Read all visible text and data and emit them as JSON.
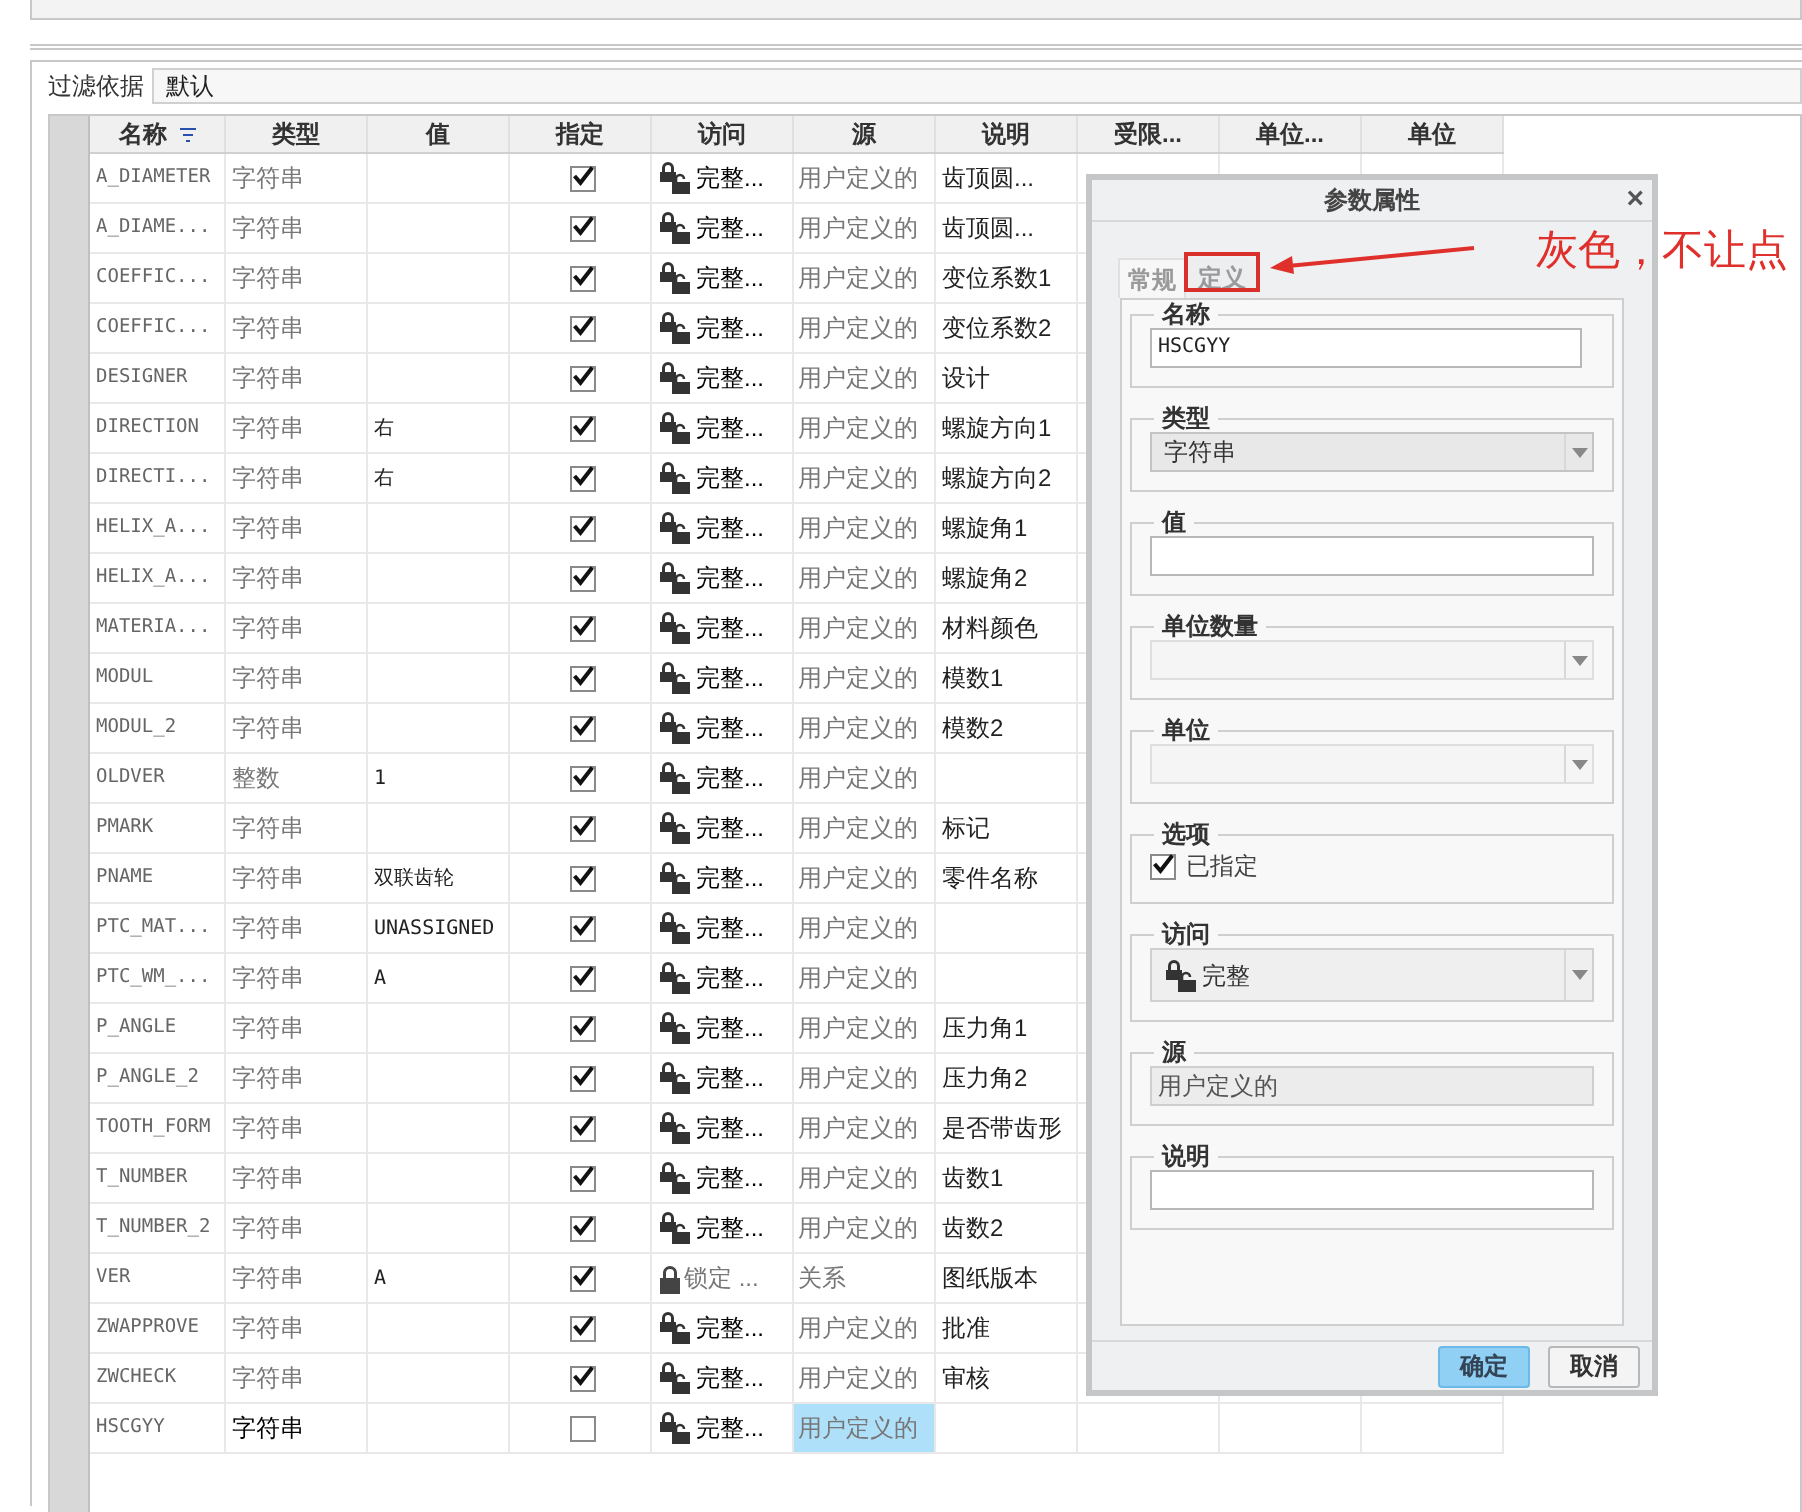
{
  "filter": {
    "label": "过滤依据",
    "value": "默认"
  },
  "table": {
    "columns": [
      "名称",
      "类型",
      "值",
      "指定",
      "访问",
      "源",
      "说明",
      "受限...",
      "单位...",
      "单位"
    ],
    "rows": [
      {
        "name": "A_DIAMETER",
        "type": "字符串",
        "value": "",
        "checked": true,
        "access": {
          "kind": "full",
          "text": "完整..."
        },
        "source": "用户定义的",
        "description": "齿顶圆...",
        "selected": false
      },
      {
        "name": "A_DIAME...",
        "type": "字符串",
        "value": "",
        "checked": true,
        "access": {
          "kind": "full",
          "text": "完整..."
        },
        "source": "用户定义的",
        "description": "齿顶圆...",
        "selected": false
      },
      {
        "name": "COEFFIC...",
        "type": "字符串",
        "value": "",
        "checked": true,
        "access": {
          "kind": "full",
          "text": "完整..."
        },
        "source": "用户定义的",
        "description": "变位系数1",
        "selected": false
      },
      {
        "name": "COEFFIC...",
        "type": "字符串",
        "value": "",
        "checked": true,
        "access": {
          "kind": "full",
          "text": "完整..."
        },
        "source": "用户定义的",
        "description": "变位系数2",
        "selected": false
      },
      {
        "name": "DESIGNER",
        "type": "字符串",
        "value": "",
        "checked": true,
        "access": {
          "kind": "full",
          "text": "完整..."
        },
        "source": "用户定义的",
        "description": "设计",
        "selected": false
      },
      {
        "name": "DIRECTION",
        "type": "字符串",
        "value": "右",
        "checked": true,
        "access": {
          "kind": "full",
          "text": "完整..."
        },
        "source": "用户定义的",
        "description": "螺旋方向1",
        "selected": false
      },
      {
        "name": "DIRECTI...",
        "type": "字符串",
        "value": "右",
        "checked": true,
        "access": {
          "kind": "full",
          "text": "完整..."
        },
        "source": "用户定义的",
        "description": "螺旋方向2",
        "selected": false
      },
      {
        "name": "HELIX_A...",
        "type": "字符串",
        "value": "",
        "checked": true,
        "access": {
          "kind": "full",
          "text": "完整..."
        },
        "source": "用户定义的",
        "description": "螺旋角1",
        "selected": false
      },
      {
        "name": "HELIX_A...",
        "type": "字符串",
        "value": "",
        "checked": true,
        "access": {
          "kind": "full",
          "text": "完整..."
        },
        "source": "用户定义的",
        "description": "螺旋角2",
        "selected": false
      },
      {
        "name": "MATERIA...",
        "type": "字符串",
        "value": "",
        "checked": true,
        "access": {
          "kind": "full",
          "text": "完整..."
        },
        "source": "用户定义的",
        "description": "材料颜色",
        "selected": false
      },
      {
        "name": "MODUL",
        "type": "字符串",
        "value": "",
        "checked": true,
        "access": {
          "kind": "full",
          "text": "完整..."
        },
        "source": "用户定义的",
        "description": "模数1",
        "selected": false
      },
      {
        "name": "MODUL_2",
        "type": "字符串",
        "value": "",
        "checked": true,
        "access": {
          "kind": "full",
          "text": "完整..."
        },
        "source": "用户定义的",
        "description": "模数2",
        "selected": false
      },
      {
        "name": "OLDVER",
        "type": "整数",
        "value": "1",
        "checked": true,
        "access": {
          "kind": "full",
          "text": "完整..."
        },
        "source": "用户定义的",
        "description": "",
        "selected": false
      },
      {
        "name": "PMARK",
        "type": "字符串",
        "value": "",
        "checked": true,
        "access": {
          "kind": "full",
          "text": "完整..."
        },
        "source": "用户定义的",
        "description": "标记",
        "selected": false
      },
      {
        "name": "PNAME",
        "type": "字符串",
        "value": "双联齿轮",
        "checked": true,
        "access": {
          "kind": "full",
          "text": "完整..."
        },
        "source": "用户定义的",
        "description": "零件名称",
        "selected": false
      },
      {
        "name": "PTC_MAT...",
        "type": "字符串",
        "value": "UNASSIGNED",
        "checked": true,
        "access": {
          "kind": "full",
          "text": "完整..."
        },
        "source": "用户定义的",
        "description": "",
        "selected": false
      },
      {
        "name": "PTC_WM_...",
        "type": "字符串",
        "value": "A",
        "checked": true,
        "access": {
          "kind": "full",
          "text": "完整..."
        },
        "source": "用户定义的",
        "description": "",
        "selected": false
      },
      {
        "name": "P_ANGLE",
        "type": "字符串",
        "value": "",
        "checked": true,
        "access": {
          "kind": "full",
          "text": "完整..."
        },
        "source": "用户定义的",
        "description": "压力角1",
        "selected": false
      },
      {
        "name": "P_ANGLE_2",
        "type": "字符串",
        "value": "",
        "checked": true,
        "access": {
          "kind": "full",
          "text": "完整..."
        },
        "source": "用户定义的",
        "description": "压力角2",
        "selected": false
      },
      {
        "name": "TOOTH_FORM",
        "type": "字符串",
        "value": "",
        "checked": true,
        "access": {
          "kind": "full",
          "text": "完整..."
        },
        "source": "用户定义的",
        "description": "是否带齿形",
        "selected": false
      },
      {
        "name": "T_NUMBER",
        "type": "字符串",
        "value": "",
        "checked": true,
        "access": {
          "kind": "full",
          "text": "完整..."
        },
        "source": "用户定义的",
        "description": "齿数1",
        "selected": false
      },
      {
        "name": "T_NUMBER_2",
        "type": "字符串",
        "value": "",
        "checked": true,
        "access": {
          "kind": "full",
          "text": "完整..."
        },
        "source": "用户定义的",
        "description": "齿数2",
        "selected": false
      },
      {
        "name": "VER",
        "type": "字符串",
        "value": "A",
        "checked": true,
        "access": {
          "kind": "locked",
          "text": "锁定 ..."
        },
        "source": "关系",
        "description": "图纸版本",
        "selected": false
      },
      {
        "name": "ZWAPPROVE",
        "type": "字符串",
        "value": "",
        "checked": true,
        "access": {
          "kind": "full",
          "text": "完整..."
        },
        "source": "用户定义的",
        "description": "批准",
        "selected": false
      },
      {
        "name": "ZWCHECK",
        "type": "字符串",
        "value": "",
        "checked": true,
        "access": {
          "kind": "full",
          "text": "完整..."
        },
        "source": "用户定义的",
        "description": "审核",
        "selected": false
      },
      {
        "name": "HSCGYY",
        "type": "字符串",
        "value": "",
        "checked": false,
        "access": {
          "kind": "full",
          "text": "完整..."
        },
        "source": "用户定义的",
        "description": "",
        "selected": true
      }
    ]
  },
  "dialog": {
    "title": "参数属性",
    "close": "×",
    "tabs": [
      {
        "label": "常规",
        "selected": true,
        "disabled": true
      },
      {
        "label": "定义",
        "selected": false,
        "disabled": true
      }
    ],
    "groups": [
      {
        "kind": "input",
        "label": "名称",
        "value": "HSCGYY",
        "short": true
      },
      {
        "kind": "select",
        "label": "类型",
        "value": "字符串",
        "disabled": false
      },
      {
        "kind": "input",
        "label": "值",
        "short": false
      },
      {
        "kind": "select",
        "label": "单位数量",
        "disabled": true
      },
      {
        "kind": "select",
        "label": "单位",
        "disabled": true
      },
      {
        "kind": "checkbox",
        "label": "选项",
        "text": "已指定",
        "checked": true
      },
      {
        "kind": "access",
        "label": "访问",
        "value": "完整"
      },
      {
        "kind": "readonly",
        "label": "源",
        "value": "用户定义的"
      },
      {
        "kind": "input",
        "label": "说明",
        "short": false
      }
    ],
    "buttons": [
      {
        "label": "确定",
        "primary": true
      },
      {
        "label": "取消",
        "primary": false
      }
    ]
  },
  "annotation": {
    "text": "灰色，不让点"
  }
}
